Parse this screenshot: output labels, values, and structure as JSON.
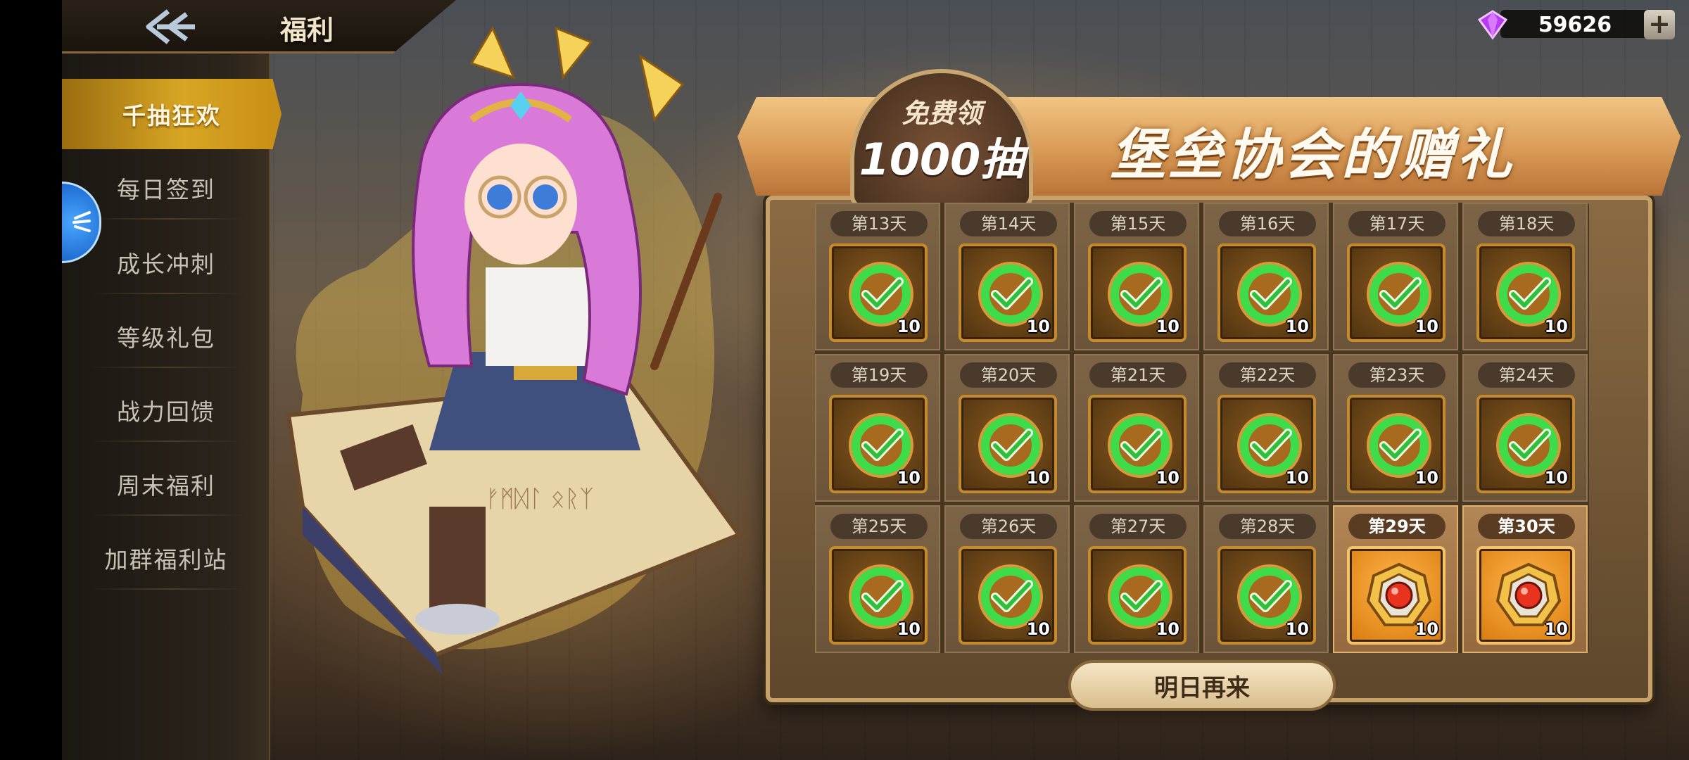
{
  "header": {
    "title": "福利",
    "back_icon": "back-arrow-icon"
  },
  "currency": {
    "value": "59626",
    "gem_icon": "purple-gem-icon",
    "plus_label": "+"
  },
  "side_tab": {
    "label": ""
  },
  "sidebar": {
    "items": [
      {
        "label": "千抽狂欢",
        "active": true
      },
      {
        "label": "每日签到",
        "active": false
      },
      {
        "label": "成长冲刺",
        "active": false
      },
      {
        "label": "等级礼包",
        "active": false
      },
      {
        "label": "战力回馈",
        "active": false
      },
      {
        "label": "周末福利",
        "active": false
      },
      {
        "label": "加群福利站",
        "active": false
      }
    ]
  },
  "banner": {
    "badge_line1": "免费领",
    "badge_line2": "1000抽",
    "title": "堡垒协会的赠礼"
  },
  "days": [
    {
      "label": "第13天",
      "qty": "10",
      "claimed": true
    },
    {
      "label": "第14天",
      "qty": "10",
      "claimed": true
    },
    {
      "label": "第15天",
      "qty": "10",
      "claimed": true
    },
    {
      "label": "第16天",
      "qty": "10",
      "claimed": true
    },
    {
      "label": "第17天",
      "qty": "10",
      "claimed": true
    },
    {
      "label": "第18天",
      "qty": "10",
      "claimed": true
    },
    {
      "label": "第19天",
      "qty": "10",
      "claimed": true
    },
    {
      "label": "第20天",
      "qty": "10",
      "claimed": true
    },
    {
      "label": "第21天",
      "qty": "10",
      "claimed": true
    },
    {
      "label": "第22天",
      "qty": "10",
      "claimed": true
    },
    {
      "label": "第23天",
      "qty": "10",
      "claimed": true
    },
    {
      "label": "第24天",
      "qty": "10",
      "claimed": true
    },
    {
      "label": "第25天",
      "qty": "10",
      "claimed": true
    },
    {
      "label": "第26天",
      "qty": "10",
      "claimed": true
    },
    {
      "label": "第27天",
      "qty": "10",
      "claimed": true
    },
    {
      "label": "第28天",
      "qty": "10",
      "claimed": true
    },
    {
      "label": "第29天",
      "qty": "10",
      "claimed": false
    },
    {
      "label": "第30天",
      "qty": "10",
      "claimed": false
    }
  ],
  "bottom_button": {
    "label": "明日再来"
  },
  "colors": {
    "accent_gold": "#d8a624",
    "check_green": "#3fdc4a",
    "claim_orange": "#ffb54a"
  }
}
